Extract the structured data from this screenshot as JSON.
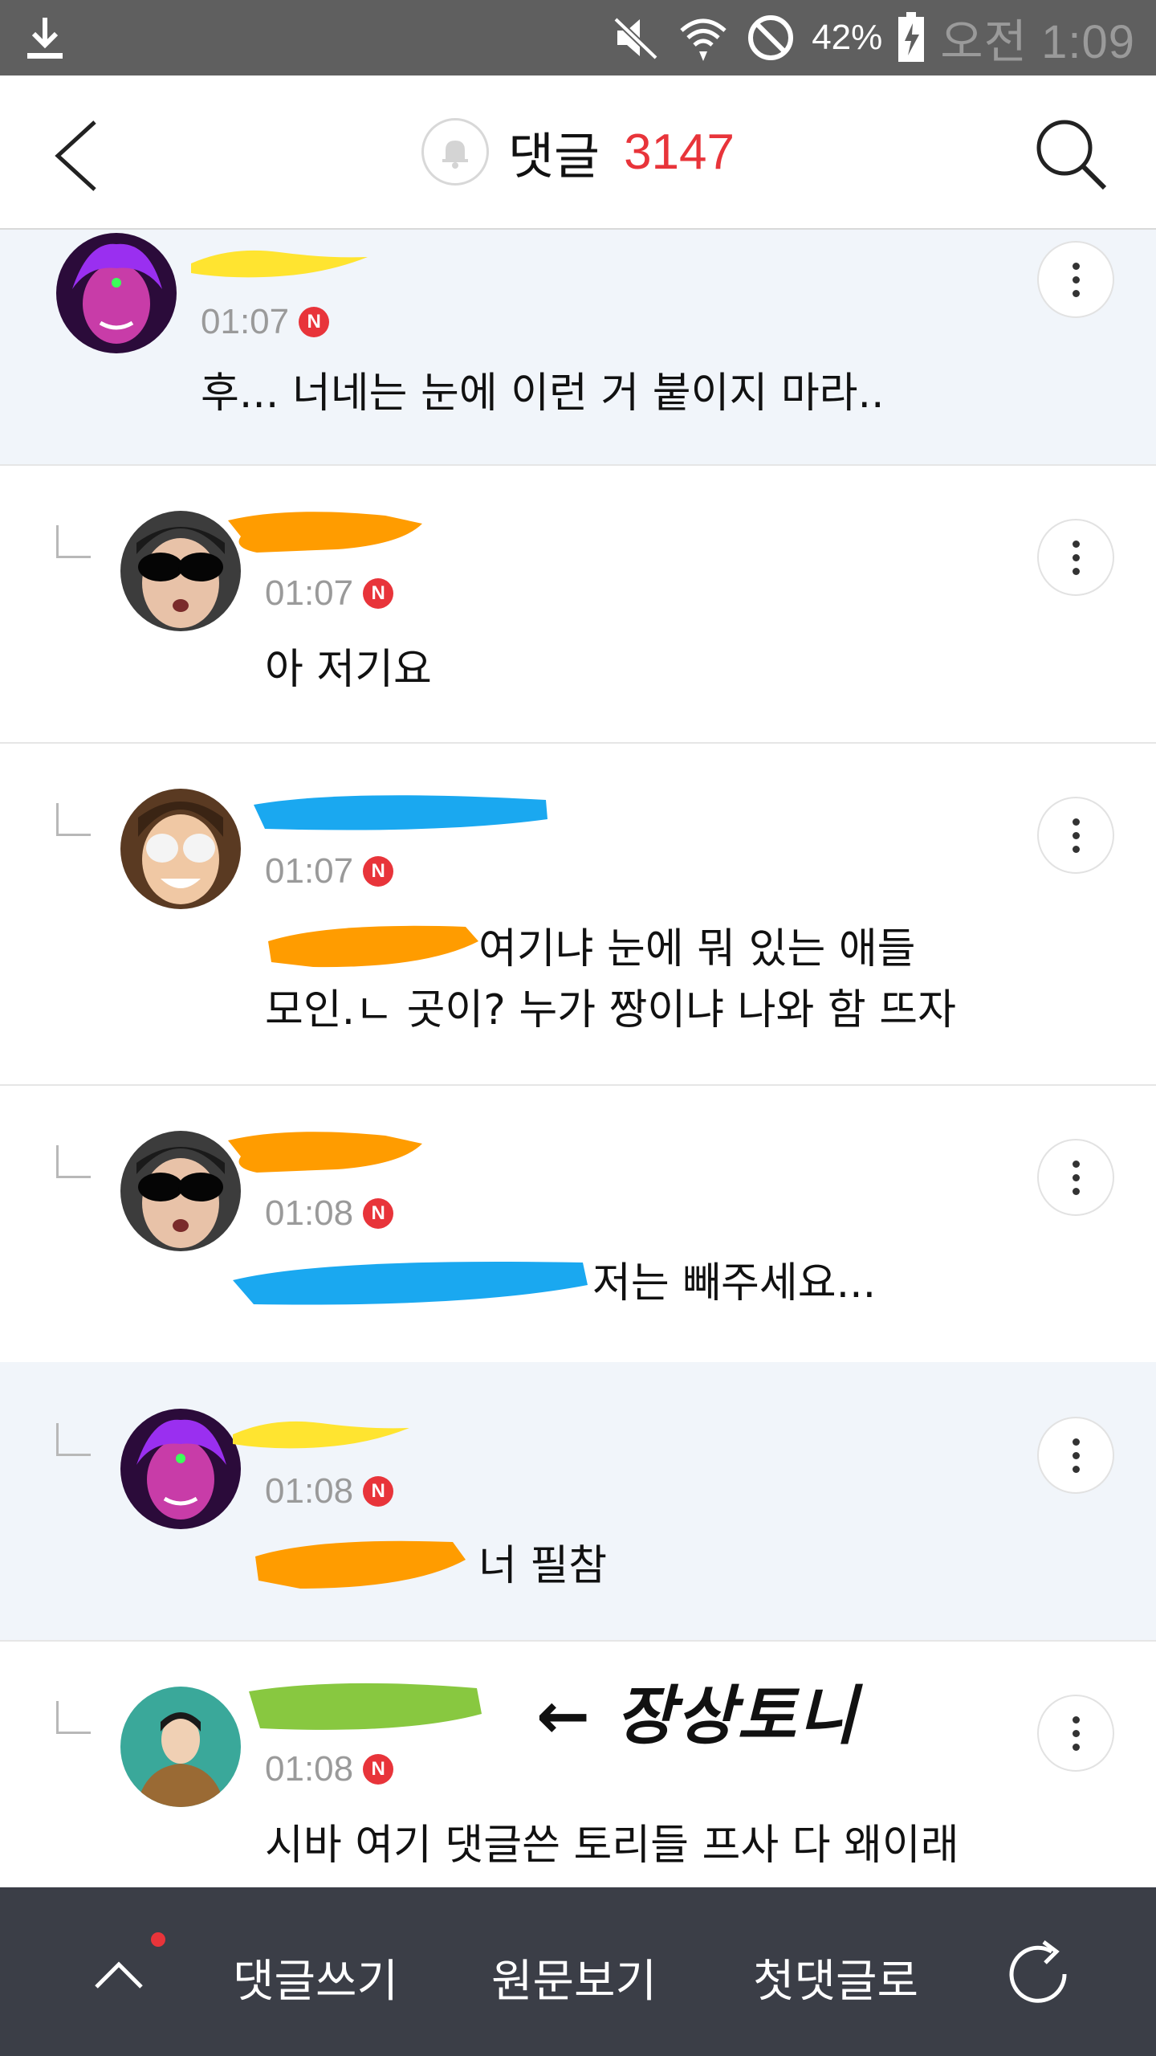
{
  "status_bar": {
    "battery": "42%",
    "time": "오전 1:09"
  },
  "header": {
    "title": "댓글",
    "count": "3147"
  },
  "comments": [
    {
      "time": "01:07",
      "badge": "N",
      "text": "후... 너네는 눈에 이런 거 붙이지 마라..",
      "reply": false,
      "highlight": true
    },
    {
      "time": "01:07",
      "badge": "N",
      "text": "아 저기요",
      "reply": true,
      "highlight": false
    },
    {
      "time": "01:07",
      "badge": "N",
      "text_line1": "여기냐 눈에 뭐 있는 애들",
      "text_line2": "모인.ㄴ 곳이? 누가 짱이냐 나와 함 뜨자",
      "reply": true,
      "highlight": false
    },
    {
      "time": "01:08",
      "badge": "N",
      "text": "저는 빼주세요...",
      "reply": true,
      "highlight": false
    },
    {
      "time": "01:08",
      "badge": "N",
      "text": "너 필참",
      "reply": true,
      "highlight": true
    },
    {
      "time": "01:08",
      "badge": "N",
      "text": "시바 여기 댓글쓴 토리들 프사 다 왜이래",
      "annotation": "← 장상토니",
      "reply": true,
      "highlight": false
    }
  ],
  "bottom_bar": {
    "write": "댓글쓰기",
    "original": "원문보기",
    "first": "첫댓글로"
  },
  "colors": {
    "accent": "#e8343a",
    "header_bg": "#ffffff",
    "status_bg": "#5f5f5f",
    "bottom_bg": "#3b3e47",
    "highlight_bg": "#f1f5fa"
  }
}
